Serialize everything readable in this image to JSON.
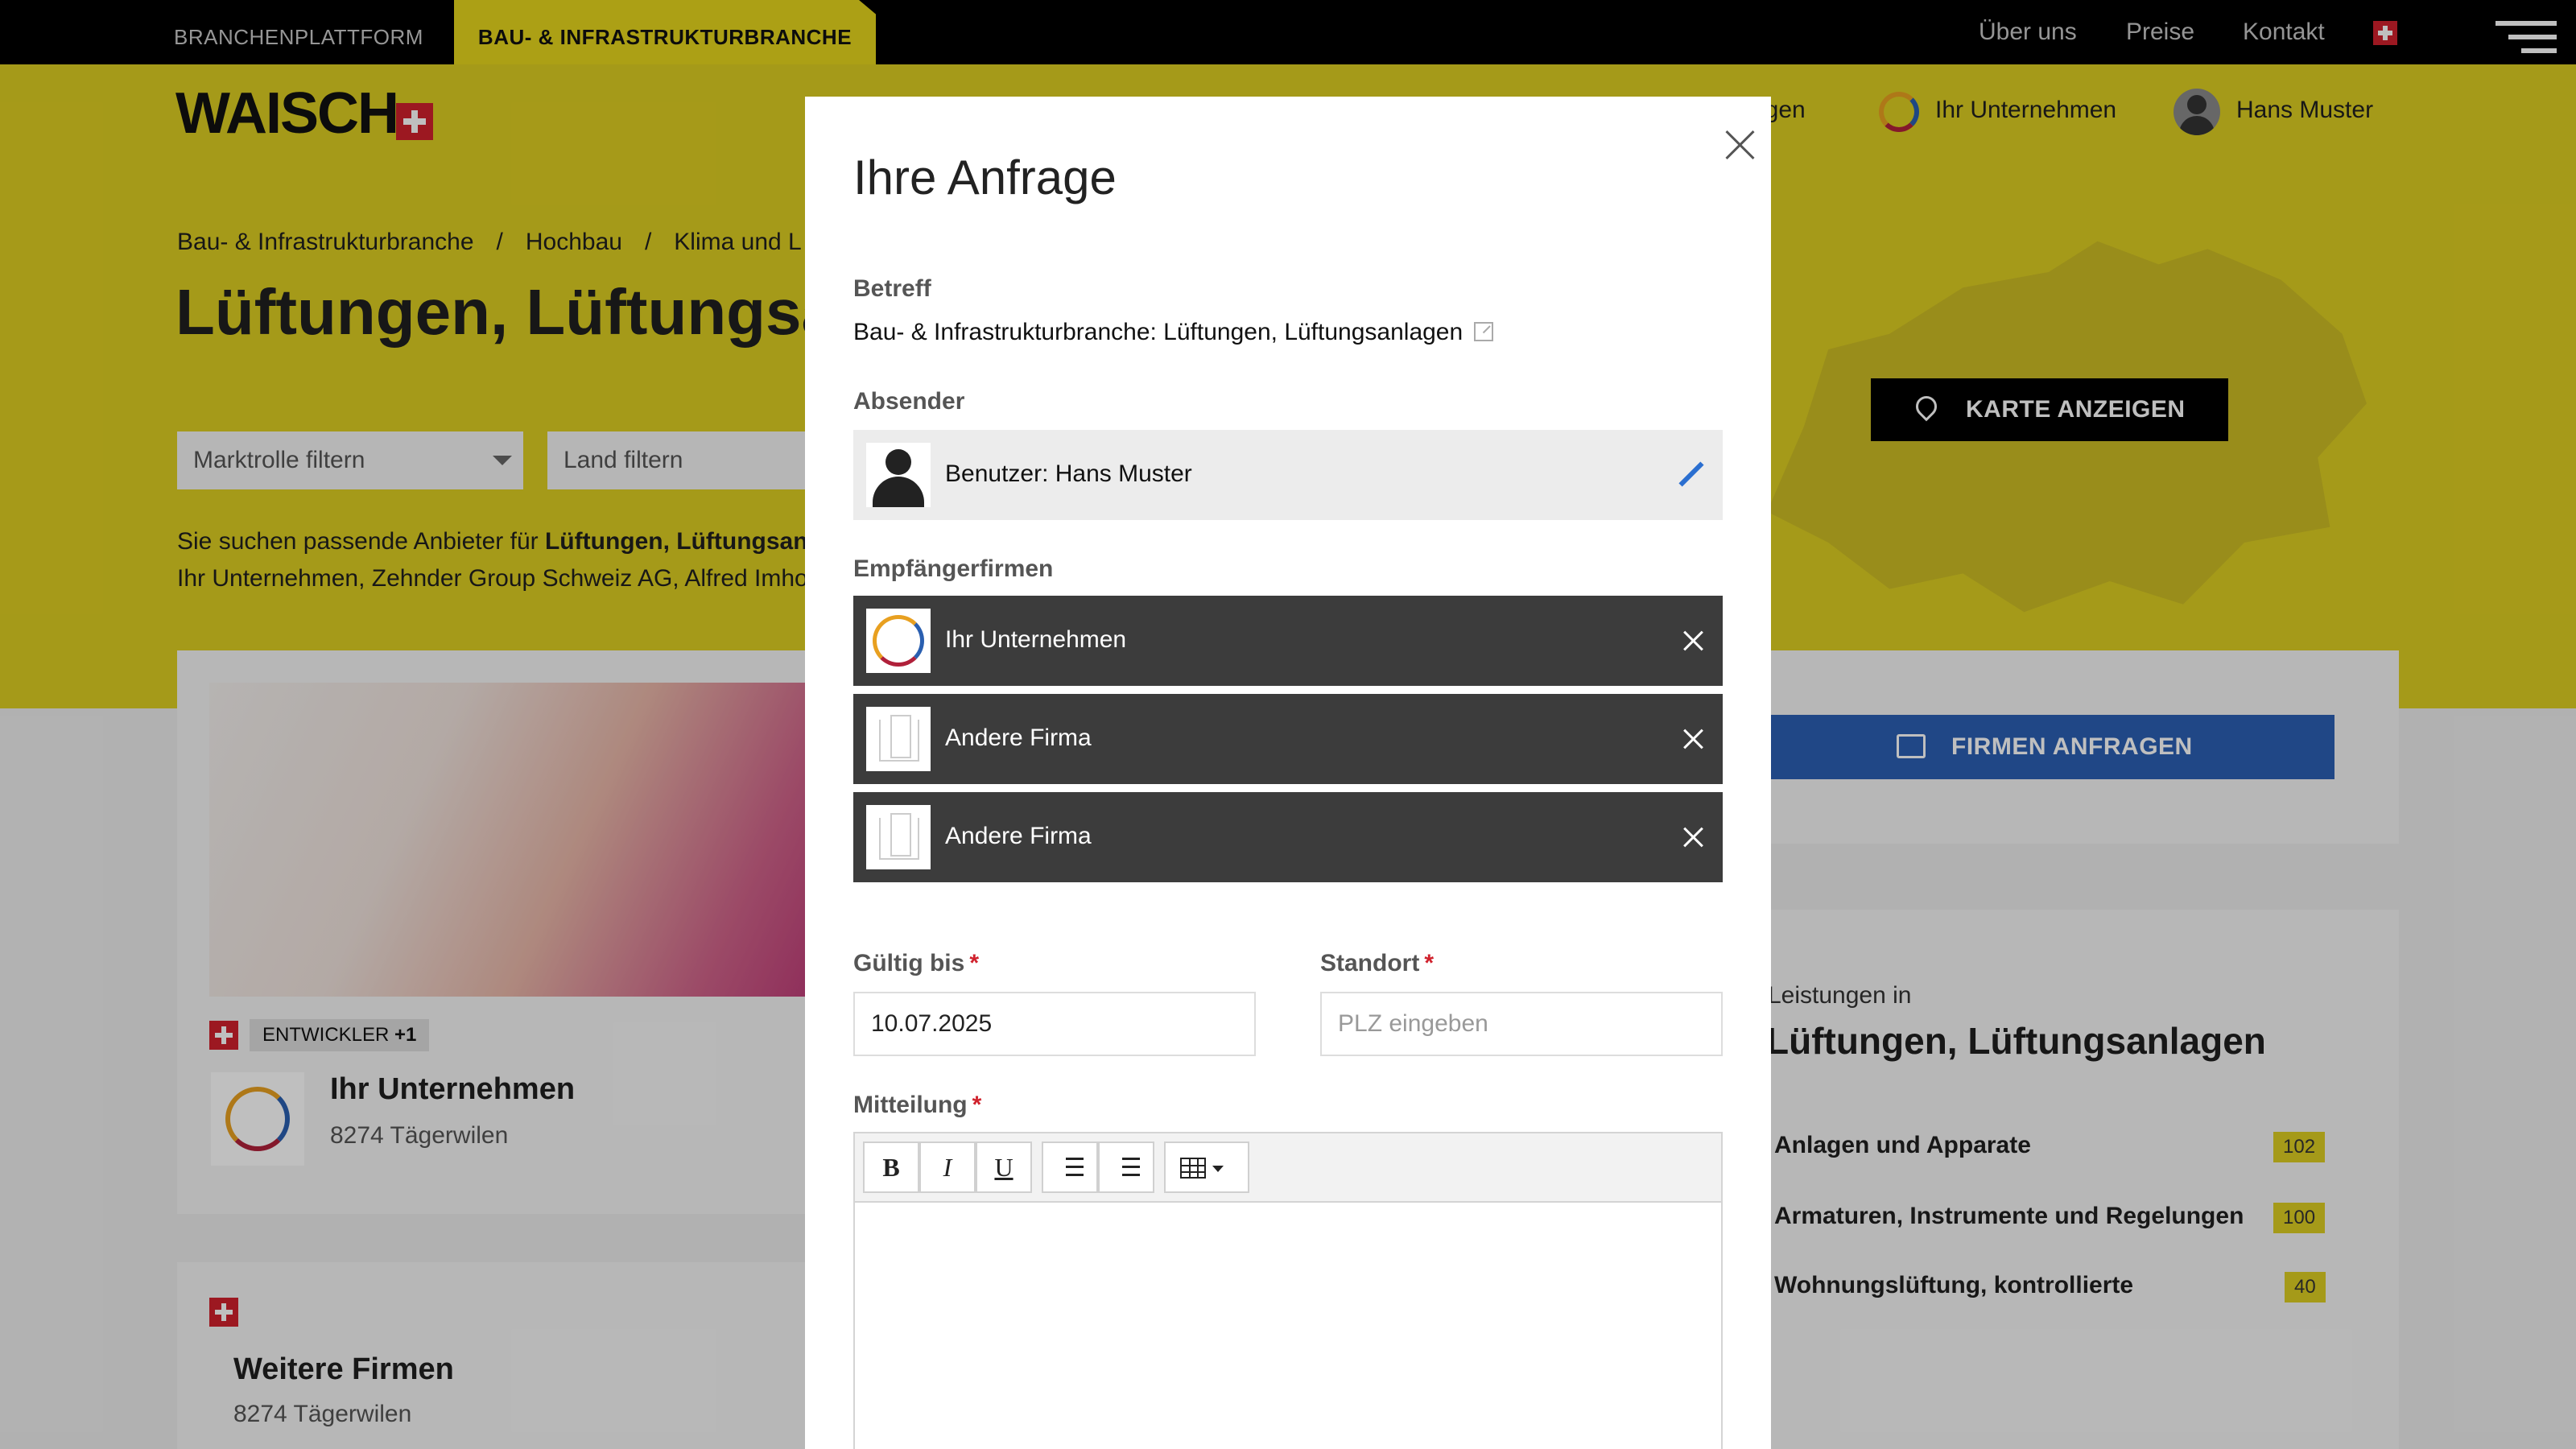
{
  "topbar": {
    "tabs": [
      "BRANCHENPLATTFORM",
      "BAU- & INFRASTRUKTURBRANCHE"
    ],
    "links": [
      "Über uns",
      "Preise",
      "Kontakt"
    ]
  },
  "header": {
    "logo": "WAISCH",
    "nav": {
      "partial": "agen",
      "company": "Ihr Unternehmen",
      "user": "Hans Muster"
    }
  },
  "breadcrumb": [
    "Bau- & Infrastrukturbranche",
    "Hochbau",
    "Klima und L"
  ],
  "page_title": "Lüftungen, Lüftungsan",
  "filters": [
    "Marktrolle filtern",
    "Land filtern"
  ],
  "intro": {
    "prefix": "Sie suchen passende Anbieter für ",
    "bold": "Lüftungen, Lüftungsan",
    "line2": "Ihr Unternehmen, Zehnder Group Schweiz AG, Alfred Imho"
  },
  "map_button": "KARTE ANZEIGEN",
  "firmen_button": "FIRMEN ANFRAGEN",
  "company_card": {
    "tag": "ENTWICKLER",
    "tag_extra": "+1",
    "name": "Ihr Unternehmen",
    "location": "8274 Tägerwilen"
  },
  "more_card": {
    "name": "Weitere Firmen",
    "location": "8274 Tägerwilen"
  },
  "services": {
    "label": "Leistungen in",
    "title": "Lüftungen, Lüftungsanlagen",
    "items": [
      {
        "name": "Anlagen und Apparate",
        "count": "102"
      },
      {
        "name": "Armaturen, Instrumente und Regelungen",
        "count": "100"
      },
      {
        "name": "Wohnungslüftung, kontrollierte",
        "count": "40"
      }
    ]
  },
  "modal": {
    "title": "Ihre Anfrage",
    "subject_label": "Betreff",
    "subject": "Bau- & Infrastrukturbranche: Lüftungen, Lüftungsanlagen",
    "sender_label": "Absender",
    "sender": "Benutzer: Hans Muster",
    "recipients_label": "Empfängerfirmen",
    "recipients": [
      "Ihr Unternehmen",
      "Andere Firma",
      "Andere Firma"
    ],
    "valid_label": "Gültig bis",
    "valid_value": "10.07.2025",
    "location_label": "Standort",
    "location_placeholder": "PLZ eingeben",
    "message_label": "Mitteilung",
    "required_mark": "*",
    "toolbar": {
      "bold": "B",
      "italic": "I",
      "underline": "U"
    }
  }
}
